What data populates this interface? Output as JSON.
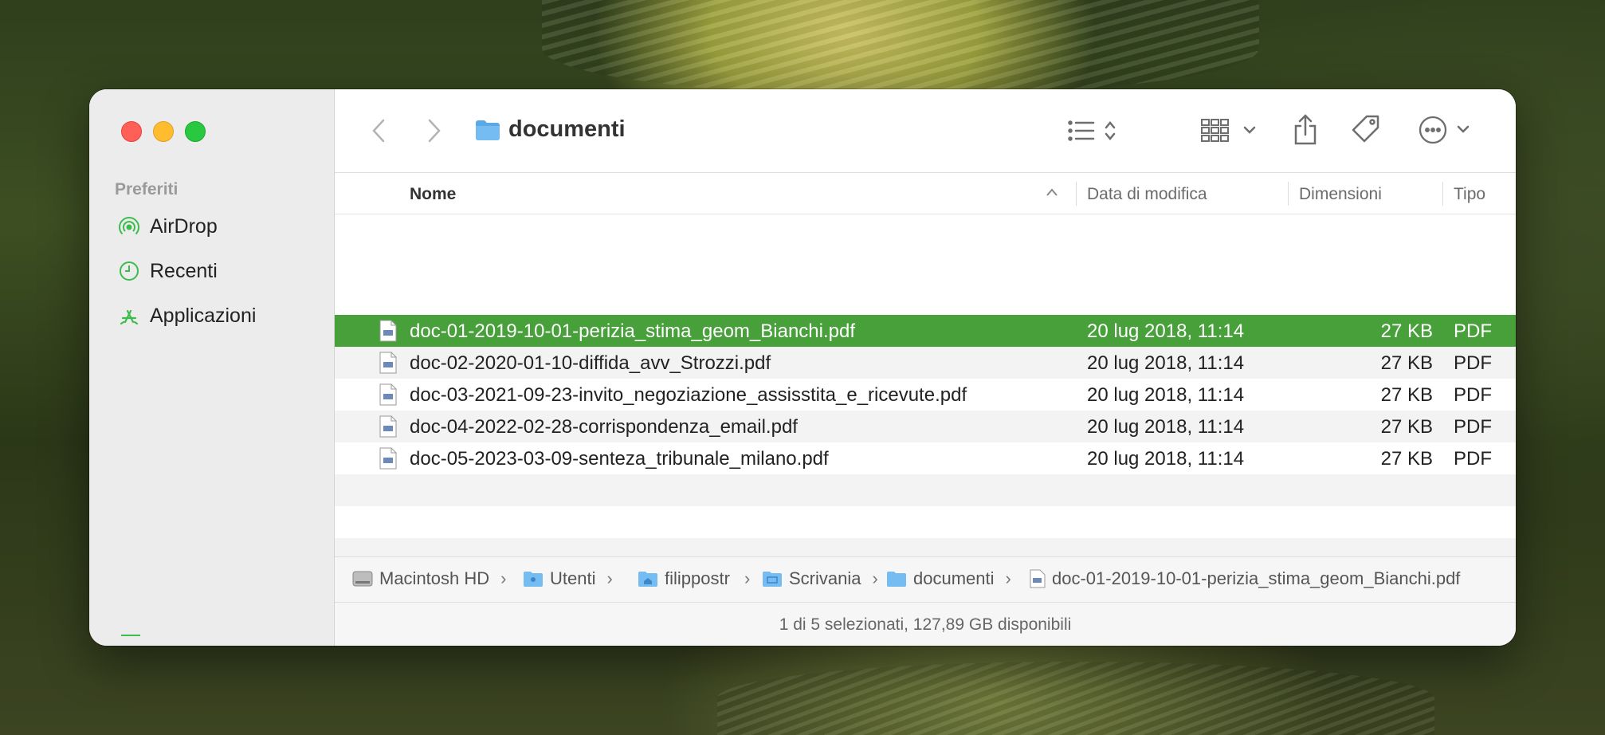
{
  "window": {
    "title": "documenti"
  },
  "sidebar": {
    "section_title": "Preferiti",
    "items": [
      {
        "label": "AirDrop",
        "icon": "airdrop-icon"
      },
      {
        "label": "Recenti",
        "icon": "clock-icon"
      },
      {
        "label": "Applicazioni",
        "icon": "applications-icon"
      }
    ],
    "accent_color": "#3dbb4c"
  },
  "columns": {
    "name": "Nome",
    "date": "Data di modifica",
    "size": "Dimensioni",
    "type": "Tipo"
  },
  "files": [
    {
      "name": "doc-01-2019-10-01-perizia_stima_geom_Bianchi.pdf",
      "date": "20 lug 2018, 11:14",
      "size": "27 KB",
      "type": "PDF",
      "selected": true
    },
    {
      "name": "doc-02-2020-01-10-diffida_avv_Strozzi.pdf",
      "date": "20 lug 2018, 11:14",
      "size": "27 KB",
      "type": "PDF",
      "selected": false
    },
    {
      "name": "doc-03-2021-09-23-invito_negoziazione_assisstita_e_ricevute.pdf",
      "date": "20 lug 2018, 11:14",
      "size": "27 KB",
      "type": "PDF",
      "selected": false
    },
    {
      "name": "doc-04-2022-02-28-corrispondenza_email.pdf",
      "date": "20 lug 2018, 11:14",
      "size": "27 KB",
      "type": "PDF",
      "selected": false
    },
    {
      "name": "doc-05-2023-03-09-senteza_tribunale_milano.pdf",
      "date": "20 lug 2018, 11:14",
      "size": "27 KB",
      "type": "PDF",
      "selected": false
    }
  ],
  "pathbar": {
    "crumbs": [
      "Macintosh HD",
      "Utenti",
      "filippostr",
      "Scrivania",
      "documenti",
      "doc-01-2019-10-01-perizia_stima_geom_Bianchi.pdf"
    ]
  },
  "status": "1 di 5 selezionati, 127,89 GB disponibili",
  "colors": {
    "selection": "#47a03a",
    "folder": "#5aa9e6"
  }
}
